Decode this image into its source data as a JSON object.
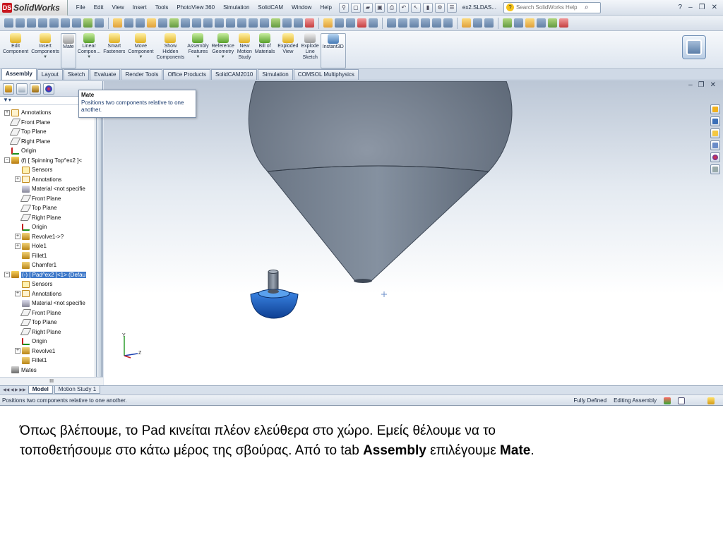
{
  "app": {
    "logo_text": "SolidWorks",
    "doc_name": "ex2.SLDAS..."
  },
  "menu": [
    "File",
    "Edit",
    "View",
    "Insert",
    "Tools",
    "PhotoView 360",
    "Simulation",
    "SolidCAM",
    "Window",
    "Help"
  ],
  "search": {
    "placeholder": "Search SolidWorks Help"
  },
  "command_manager": [
    {
      "label": "Edit\nComponent",
      "icon": "edit-component-icon"
    },
    {
      "label": "Insert\nComponents",
      "icon": "insert-components-icon"
    },
    {
      "label": "Mate",
      "icon": "mate-icon",
      "active": true
    },
    {
      "label": "Linear\nCompon...",
      "icon": "linear-pattern-icon"
    },
    {
      "label": "Smart\nFasteners",
      "icon": "smart-fasteners-icon"
    },
    {
      "label": "Move\nComponent",
      "icon": "move-component-icon"
    },
    {
      "label": "Show\nHidden\nComponents",
      "icon": "show-hidden-icon"
    },
    {
      "label": "Assembly\nFeatures",
      "icon": "assembly-features-icon"
    },
    {
      "label": "Reference\nGeometry",
      "icon": "reference-geometry-icon"
    },
    {
      "label": "New\nMotion\nStudy",
      "icon": "motion-study-icon"
    },
    {
      "label": "Bill of\nMaterials",
      "icon": "bom-icon"
    },
    {
      "label": "Exploded\nView",
      "icon": "exploded-view-icon"
    },
    {
      "label": "Explode\nLine\nSketch",
      "icon": "explode-line-icon"
    },
    {
      "label": "Instant3D",
      "icon": "instant3d-icon"
    }
  ],
  "tabs": [
    "Assembly",
    "Layout",
    "Sketch",
    "Evaluate",
    "Render Tools",
    "Office Products",
    "SolidCAM2010",
    "Simulation",
    "COMSOL Multiphysics"
  ],
  "tooltip": {
    "title": "Mate",
    "text": "Positions two components relative to one another."
  },
  "tree": [
    {
      "label": "Annotations",
      "icon": "annotations-icon",
      "indent": 0,
      "exp": "+"
    },
    {
      "label": "Front Plane",
      "icon": "plane-icon",
      "indent": 0
    },
    {
      "label": "Top Plane",
      "icon": "plane-icon",
      "indent": 0
    },
    {
      "label": "Right Plane",
      "icon": "plane-icon",
      "indent": 0
    },
    {
      "label": "Origin",
      "icon": "origin-icon",
      "indent": 0
    },
    {
      "label": "(f) [ Spinning Top^ex2 ]<",
      "icon": "part-icon",
      "indent": 0,
      "exp": "−"
    },
    {
      "label": "Sensors",
      "icon": "sensors-icon",
      "indent": 1
    },
    {
      "label": "Annotations",
      "icon": "annotations-icon",
      "indent": 1,
      "exp": "+"
    },
    {
      "label": "Material <not specifie",
      "icon": "material-icon",
      "indent": 1
    },
    {
      "label": "Front Plane",
      "icon": "plane-icon",
      "indent": 1
    },
    {
      "label": "Top Plane",
      "icon": "plane-icon",
      "indent": 1
    },
    {
      "label": "Right Plane",
      "icon": "plane-icon",
      "indent": 1
    },
    {
      "label": "Origin",
      "icon": "origin-icon",
      "indent": 1
    },
    {
      "label": "Revolve1->?",
      "icon": "revolve-icon",
      "indent": 1,
      "exp": "+"
    },
    {
      "label": "Hole1",
      "icon": "hole-icon",
      "indent": 1,
      "exp": "+"
    },
    {
      "label": "Fillet1",
      "icon": "fillet-icon",
      "indent": 1
    },
    {
      "label": "Chamfer1",
      "icon": "chamfer-icon",
      "indent": 1
    },
    {
      "label": "(-) [ Pad^ex2 ]<1> (Defau",
      "icon": "part-icon",
      "indent": 0,
      "exp": "−",
      "selected": true
    },
    {
      "label": "Sensors",
      "icon": "sensors-icon",
      "indent": 1
    },
    {
      "label": "Annotations",
      "icon": "annotations-icon",
      "indent": 1,
      "exp": "+"
    },
    {
      "label": "Material <not specifie",
      "icon": "material-icon",
      "indent": 1
    },
    {
      "label": "Front Plane",
      "icon": "plane-icon",
      "indent": 1
    },
    {
      "label": "Top Plane",
      "icon": "plane-icon",
      "indent": 1
    },
    {
      "label": "Right Plane",
      "icon": "plane-icon",
      "indent": 1
    },
    {
      "label": "Origin",
      "icon": "origin-icon",
      "indent": 1
    },
    {
      "label": "Revolve1",
      "icon": "revolve-icon",
      "indent": 1,
      "exp": "+"
    },
    {
      "label": "Fillet1",
      "icon": "fillet-icon",
      "indent": 1
    },
    {
      "label": "Mates",
      "icon": "mates-icon",
      "indent": 0
    }
  ],
  "fm_hscroll": "III",
  "bottom_tabs": [
    "Model",
    "Motion Study 1"
  ],
  "status": {
    "message": "Positions two components relative to one another.",
    "defined": "Fully Defined",
    "mode": "Editing Assembly"
  },
  "colors": {
    "model_gray": "#6d7888",
    "pad_blue": "#1f64c8"
  },
  "caption": {
    "line1": "Όπως βλέπουμε, το Pad κινείται πλέον ελεύθερα στο χώρο. Εμείς θέλουμε να το",
    "line2_pre": "τοποθετήσουμε στο κάτω μέρος της σβούρας. Από το tab ",
    "bold1": "Assembly",
    "line2_mid": " επιλέγουμε ",
    "bold2": "Mate",
    "line2_end": "."
  }
}
